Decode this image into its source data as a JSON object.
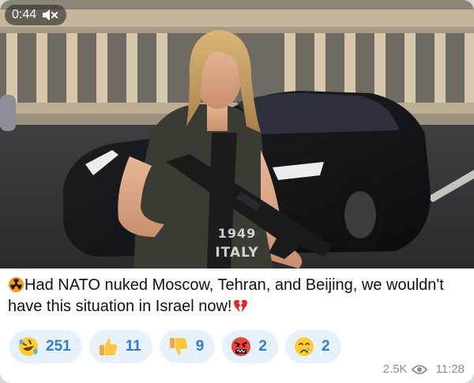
{
  "video": {
    "duration": "0:44",
    "mute_icon": "speaker-muted-icon",
    "watermark_year": "1949",
    "watermark_place": "ITALY"
  },
  "post": {
    "caption_emoji": "radioactive-icon",
    "caption_text": "Had NATO nuked Moscow, Tehran, and Beijing, we wouldn't have this situation in Israel now!",
    "caption_trailing_emoji": "broken-heart-icon"
  },
  "reactions": [
    {
      "emoji": "rofl-face-icon",
      "count": "251"
    },
    {
      "emoji": "thumbs-up-icon",
      "count": "11"
    },
    {
      "emoji": "thumbs-down-icon",
      "count": "9"
    },
    {
      "emoji": "angry-cursing-face-icon",
      "count": "2"
    },
    {
      "emoji": "crying-face-icon",
      "count": "2"
    }
  ],
  "meta": {
    "views": "2.5K",
    "views_icon": "eye-icon",
    "time": "11:28"
  },
  "colors": {
    "reaction_bg": "#e7f1fb",
    "reaction_text": "#2f7fc8",
    "meta_text": "#8a8f94"
  }
}
